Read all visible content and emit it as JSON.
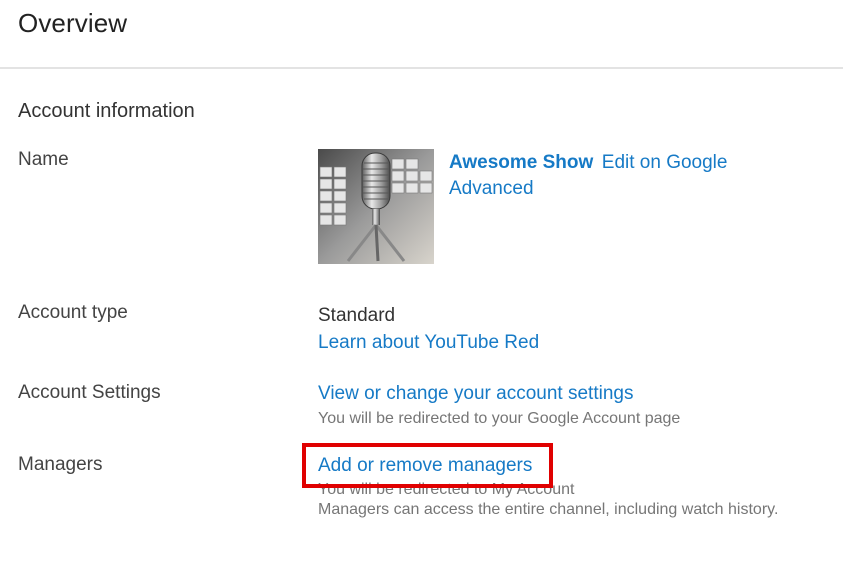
{
  "header": {
    "title": "Overview"
  },
  "section": {
    "title": "Account information"
  },
  "rows": {
    "name": {
      "label": "Name",
      "channel_name": "Awesome Show",
      "edit_link": "Edit on Google",
      "advanced_link": "Advanced",
      "thumbnail_icon": "microphone-photo"
    },
    "account_type": {
      "label": "Account type",
      "value": "Standard",
      "link": "Learn about YouTube Red"
    },
    "account_settings": {
      "label": "Account Settings",
      "link": "View or change your account settings",
      "note": "You will be redirected to your Google Account page"
    },
    "managers": {
      "label": "Managers",
      "link": "Add or remove managers",
      "note1": "You will be redirected to My Account",
      "note2": "Managers can access the entire channel, including watch history."
    }
  },
  "colors": {
    "link": "#167ac6",
    "highlight": "#e00000",
    "divider": "#e3e3e3"
  }
}
